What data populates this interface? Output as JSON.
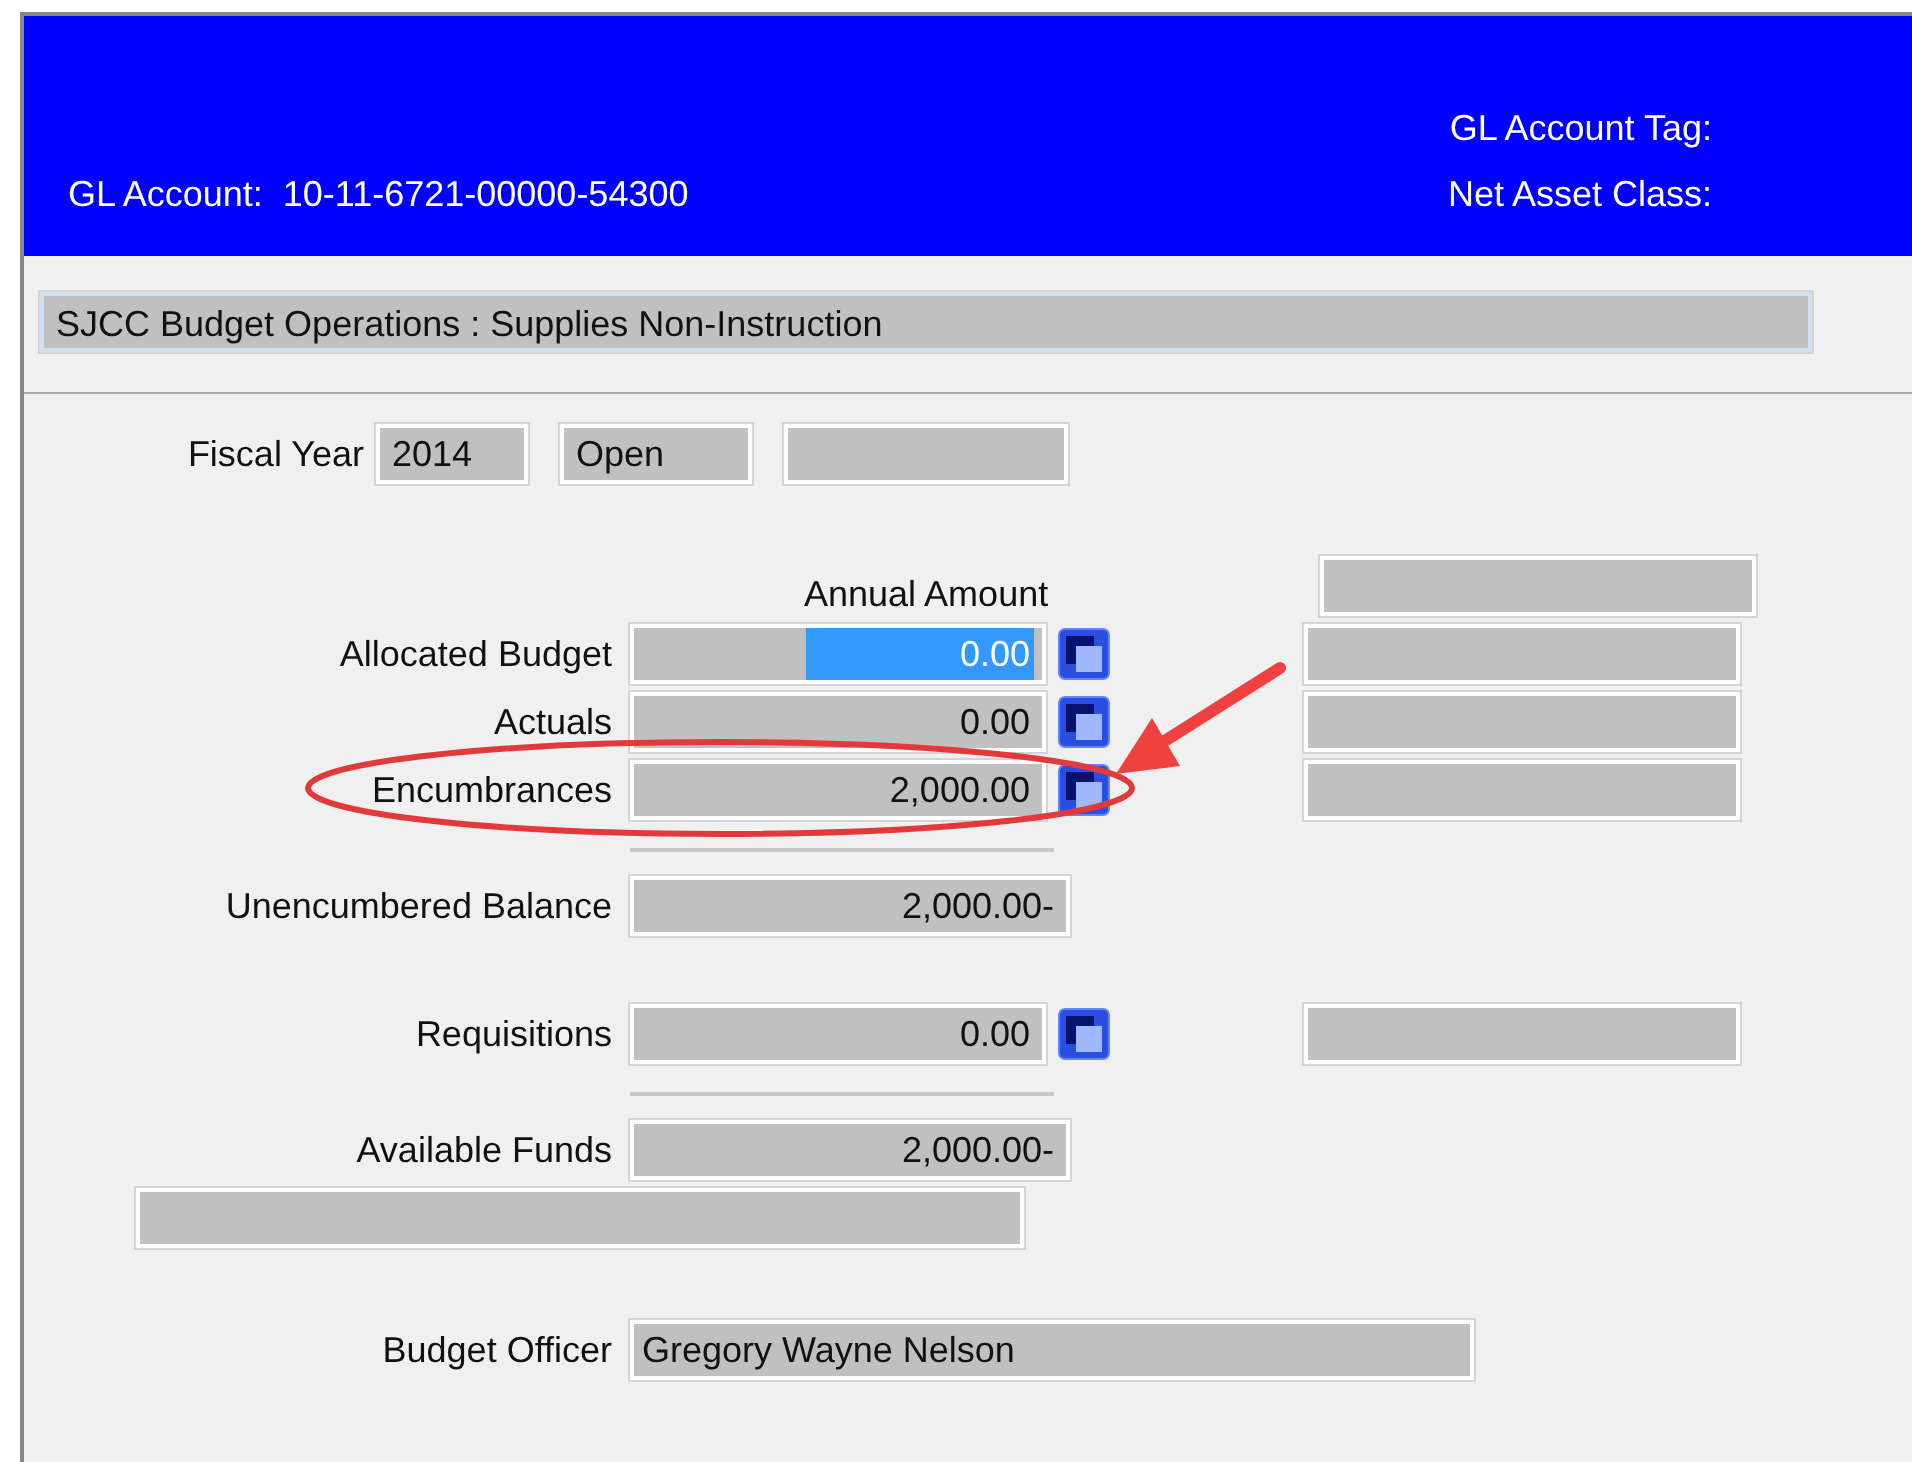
{
  "header": {
    "account_label": "GL Account:",
    "account": "10-11-6721-00000-54300",
    "tag_label": "GL Account Tag:",
    "class_label": "Net Asset Class:"
  },
  "description": "SJCC Budget Operations : Supplies Non-Instruction",
  "fiscal_year": {
    "label": "Fiscal Year",
    "year": "2014",
    "status": "Open"
  },
  "amounts": {
    "column_heading": "Annual Amount",
    "rows": [
      {
        "kind": "amount",
        "label": "Allocated Budget",
        "value": "0.00",
        "selected": true,
        "button": true,
        "side_field": true
      },
      {
        "kind": "amount",
        "label": "Actuals",
        "value": "0.00",
        "selected": false,
        "button": true,
        "side_field": true
      },
      {
        "kind": "amount",
        "label": "Encumbrances",
        "value": "2,000.00",
        "selected": false,
        "button": true,
        "side_field": true
      },
      {
        "kind": "rule"
      },
      {
        "kind": "total",
        "label": "Unencumbered Balance",
        "value": "2,000.00-",
        "selected": false,
        "button": false,
        "side_field": false
      },
      {
        "kind": "amount",
        "label": "Requisitions",
        "value": "0.00",
        "selected": false,
        "button": true,
        "side_field": true
      },
      {
        "kind": "rule"
      },
      {
        "kind": "total",
        "label": "Available Funds",
        "value": "2,000.00-",
        "selected": false,
        "button": false,
        "side_field": false
      }
    ]
  },
  "budget_officer": {
    "label": "Budget Officer",
    "value": "Gregory Wayne Nelson"
  }
}
